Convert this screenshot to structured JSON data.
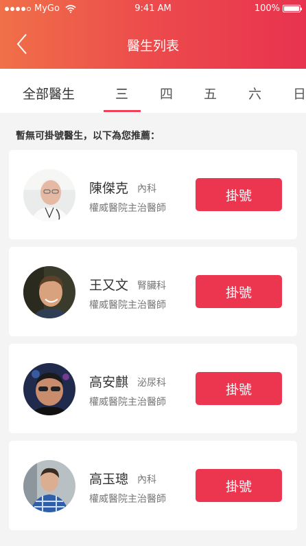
{
  "status_bar": {
    "carrier": "MyGo",
    "time": "9:41 AM",
    "battery": "100%"
  },
  "header": {
    "title": "醫生列表",
    "back_icon": "chevron-left-icon"
  },
  "tabs": {
    "all": "全部醫生",
    "days": [
      "三",
      "四",
      "五",
      "六",
      "日"
    ],
    "selected": "三"
  },
  "notice": "暫無可掛號醫生，以下為您推薦：",
  "doctors": [
    {
      "name": "陳傑克",
      "dept": "內科",
      "title": "權威醫院主治醫師",
      "button": "掛號"
    },
    {
      "name": "王又文",
      "dept": "腎臟科",
      "title": "權威醫院主治醫師",
      "button": "掛號"
    },
    {
      "name": "高安麒",
      "dept": "泌尿科",
      "title": "權威醫院主治醫師",
      "button": "掛號"
    },
    {
      "name": "高玉璁",
      "dept": "內科",
      "title": "權威醫院主治醫師",
      "button": "掛號"
    }
  ],
  "colors": {
    "accent": "#ec354f",
    "header_start": "#f07048",
    "header_end": "#e8334f"
  }
}
